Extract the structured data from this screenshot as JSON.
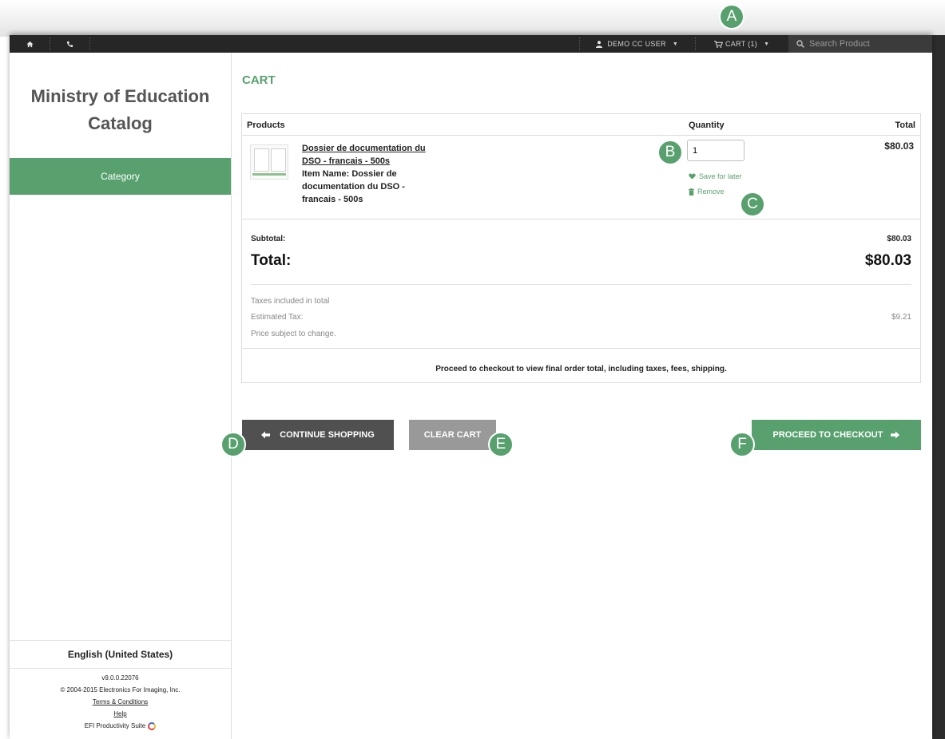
{
  "topbar": {
    "user_label": "DEMO CC USER",
    "cart_label": "CART (1)",
    "search_placeholder": "Search Product"
  },
  "sidebar": {
    "title_line1": "Ministry of Education",
    "title_line2": "Catalog",
    "category_label": "Category",
    "language": "English (United States)",
    "version": "v9.0.0.22076",
    "copyright": "© 2004-2015 Electronics For Imaging, Inc.",
    "terms_label": "Terms & Conditions",
    "help_label": "Help",
    "suite_label": "EFI Productivity Suite"
  },
  "cart": {
    "heading": "CART",
    "columns": {
      "products": "Products",
      "quantity": "Quantity",
      "total": "Total"
    },
    "item": {
      "name_line1": "Dossier de documentation du",
      "name_line2": "DSO - francais - 500s",
      "item_name_lines": [
        "Item Name: Dossier de",
        "documentation du DSO -",
        "francais - 500s"
      ],
      "quantity": "1",
      "price": "$80.03",
      "save_label": "Save for later",
      "remove_label": "Remove"
    },
    "subtotal_label": "Subtotal:",
    "subtotal_value": "$80.03",
    "total_label": "Total:",
    "total_value": "$80.03",
    "taxes_included": "Taxes included in total",
    "estimated_tax_label": "Estimated Tax:",
    "estimated_tax_value": "$9.21",
    "price_note": "Price subject to change.",
    "proceed_note": "Proceed to checkout to view final order total, including taxes, fees, shipping."
  },
  "buttons": {
    "continue": "CONTINUE SHOPPING",
    "clear": "CLEAR CART",
    "checkout": "PROCEED TO CHECKOUT"
  },
  "markers": {
    "a": "A",
    "b": "B",
    "c": "C",
    "d": "D",
    "e": "E",
    "f": "F"
  },
  "colors": {
    "accent": "#58a16e",
    "topbar": "#262626",
    "continue_button": "#505050",
    "clear_button": "#999999"
  }
}
